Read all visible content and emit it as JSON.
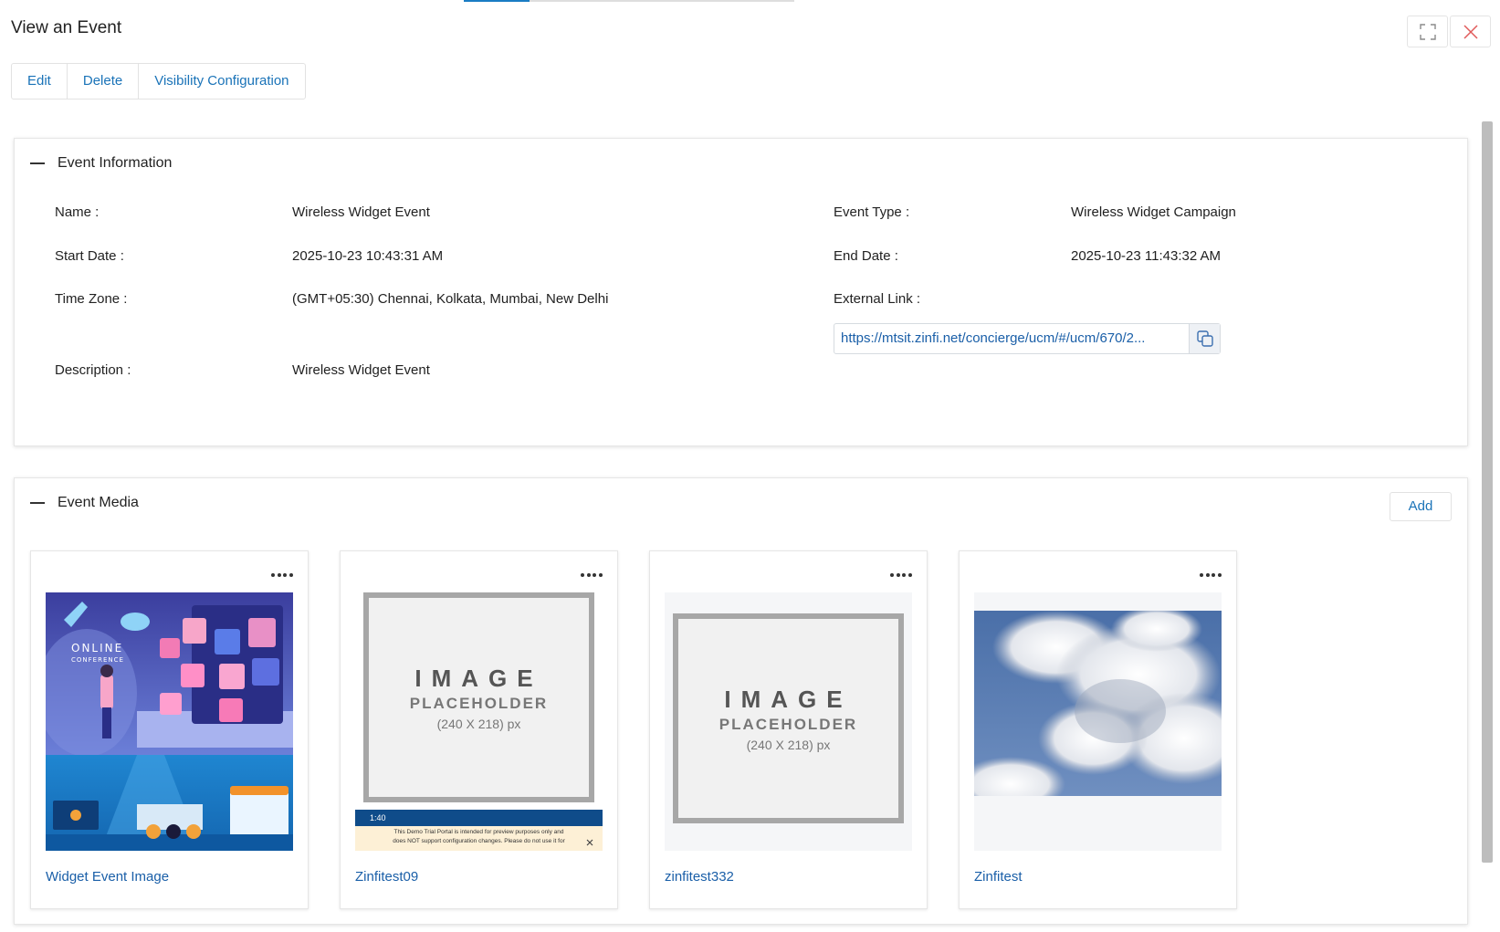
{
  "header": {
    "title": "View an Event",
    "progress_fraction": 0.2
  },
  "toolbar": {
    "edit_label": "Edit",
    "delete_label": "Delete",
    "visibility_label": "Visibility Configuration"
  },
  "window_controls": {
    "expand_icon": "expand-icon",
    "close_icon": "close-icon",
    "close_color": "#e05a5a"
  },
  "event_info": {
    "title": "Event Information",
    "fields": {
      "name_label": "Name :",
      "name_value": "Wireless Widget Event",
      "event_type_label": "Event Type :",
      "event_type_value": "Wireless Widget Campaign",
      "start_date_label": "Start Date :",
      "start_date_value": "2025-10-23 10:43:31 AM",
      "end_date_label": "End Date :",
      "end_date_value": "2025-10-23 11:43:32 AM",
      "time_zone_label": "Time Zone :",
      "time_zone_value": "(GMT+05:30) Chennai, Kolkata, Mumbai, New Delhi",
      "external_link_label": "External Link :",
      "external_link_value": "https://mtsit.zinfi.net/concierge/ucm/#/ucm/670/2...",
      "description_label": "Description :",
      "description_value": "Wireless Widget Event"
    }
  },
  "event_media": {
    "title": "Event Media",
    "add_label": "Add",
    "items": [
      {
        "name": "Widget Event Image",
        "thumb": "online-conference-illustration",
        "overlay_text": [
          "ONLINE",
          "CONFERENCE"
        ]
      },
      {
        "name": "Zinfitest09",
        "thumb": "image-placeholder",
        "placeholder": [
          "IMAGE",
          "PLACEHOLDER",
          "(240 X 218) px"
        ],
        "banner": {
          "time": "1:40",
          "lines": [
            "This Demo Trial Portal is intended for preview purposes only and",
            "does NOT support configuration changes. Please do not use it for"
          ]
        }
      },
      {
        "name": "zinfitest332",
        "thumb": "image-placeholder",
        "placeholder": [
          "IMAGE",
          "PLACEHOLDER",
          "(240 X 218) px"
        ]
      },
      {
        "name": "Zinfitest",
        "thumb": "cloud-sky-photo"
      }
    ]
  },
  "colors": {
    "accent": "#1a73b8",
    "link": "#1a5fa8",
    "progress": "#1a7cc4"
  }
}
